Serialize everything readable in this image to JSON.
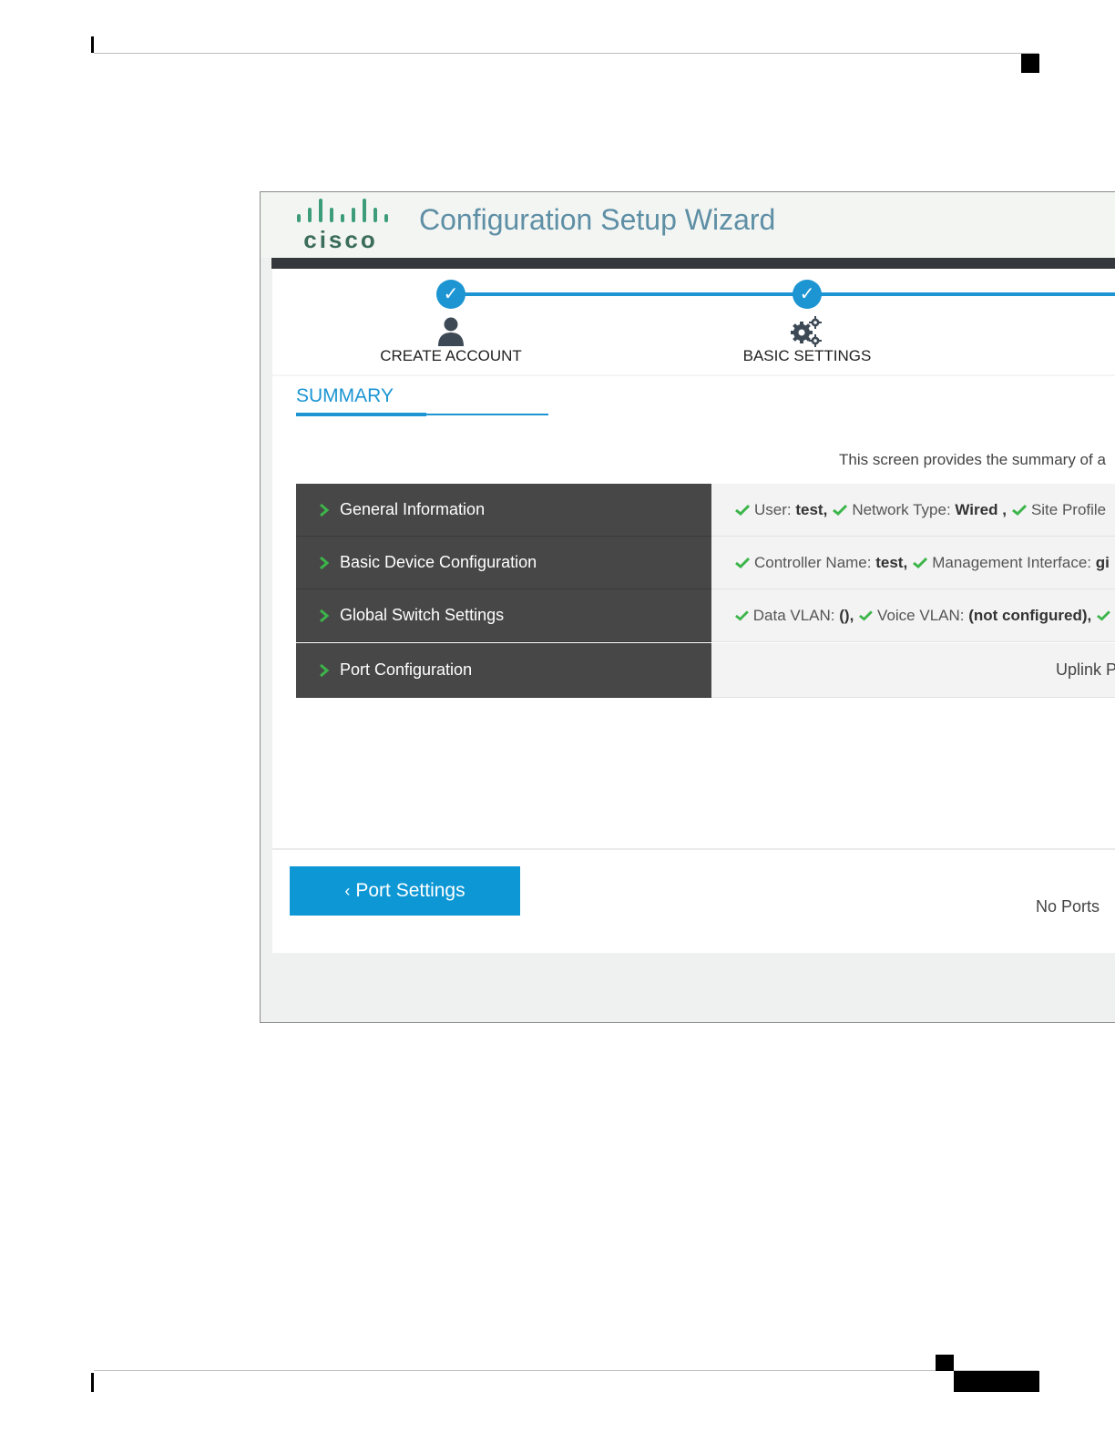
{
  "app": {
    "brand": "cisco",
    "title": "Configuration Setup Wizard"
  },
  "steps": [
    {
      "label": "CREATE ACCOUNT",
      "icon": "user-icon",
      "status": "completed"
    },
    {
      "label": "BASIC SETTINGS",
      "icon": "gears-icon",
      "status": "completed"
    }
  ],
  "tabs": {
    "summary_label": "SUMMARY"
  },
  "intro_text": "This screen provides the summary of a",
  "summary_rows": [
    {
      "heading": "General Information",
      "items": [
        {
          "label": "User:",
          "value": "test,"
        },
        {
          "label": "Network Type:",
          "value": "Wired ,"
        },
        {
          "label": "Site Profile",
          "value": ""
        }
      ]
    },
    {
      "heading": "Basic Device Configuration",
      "items": [
        {
          "label": "Controller Name:",
          "value": "test,"
        },
        {
          "label": "Management Interface:",
          "value": "gi"
        }
      ]
    },
    {
      "heading": "Global Switch Settings",
      "items": [
        {
          "label": "Data VLAN:",
          "value": "(),"
        },
        {
          "label": "Voice VLAN:",
          "value": "(not configured),"
        }
      ]
    },
    {
      "heading": "Port Configuration",
      "value_text": "Uplink P"
    }
  ],
  "no_ports_text": "No Ports",
  "back_button": {
    "label": "Port Settings"
  },
  "colors": {
    "accent": "#1d95d3",
    "row_header_bg": "#474747",
    "check_green": "#3cb54a",
    "title_color": "#5e8fa5"
  }
}
